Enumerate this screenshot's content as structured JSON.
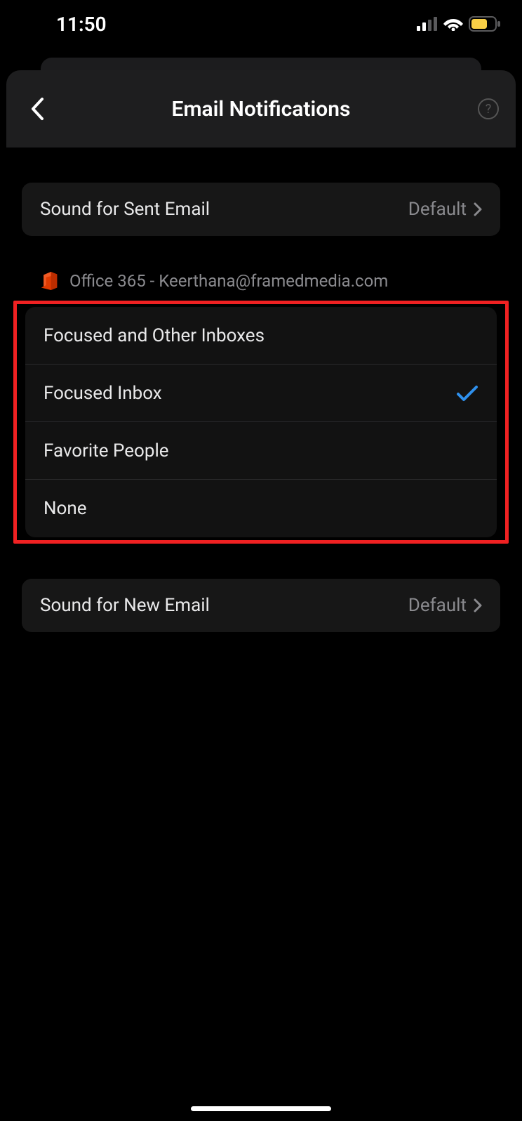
{
  "status": {
    "time": "11:50"
  },
  "header": {
    "title": "Email Notifications"
  },
  "sentSound": {
    "label": "Sound for Sent Email",
    "value": "Default"
  },
  "account": {
    "label": "Office 365 - Keerthana@framedmedia.com"
  },
  "options": {
    "items": [
      {
        "label": "Focused and Other Inboxes",
        "selected": false
      },
      {
        "label": "Focused Inbox",
        "selected": true
      },
      {
        "label": "Favorite People",
        "selected": false
      },
      {
        "label": "None",
        "selected": false
      }
    ]
  },
  "newSound": {
    "label": "Sound for New Email",
    "value": "Default"
  }
}
